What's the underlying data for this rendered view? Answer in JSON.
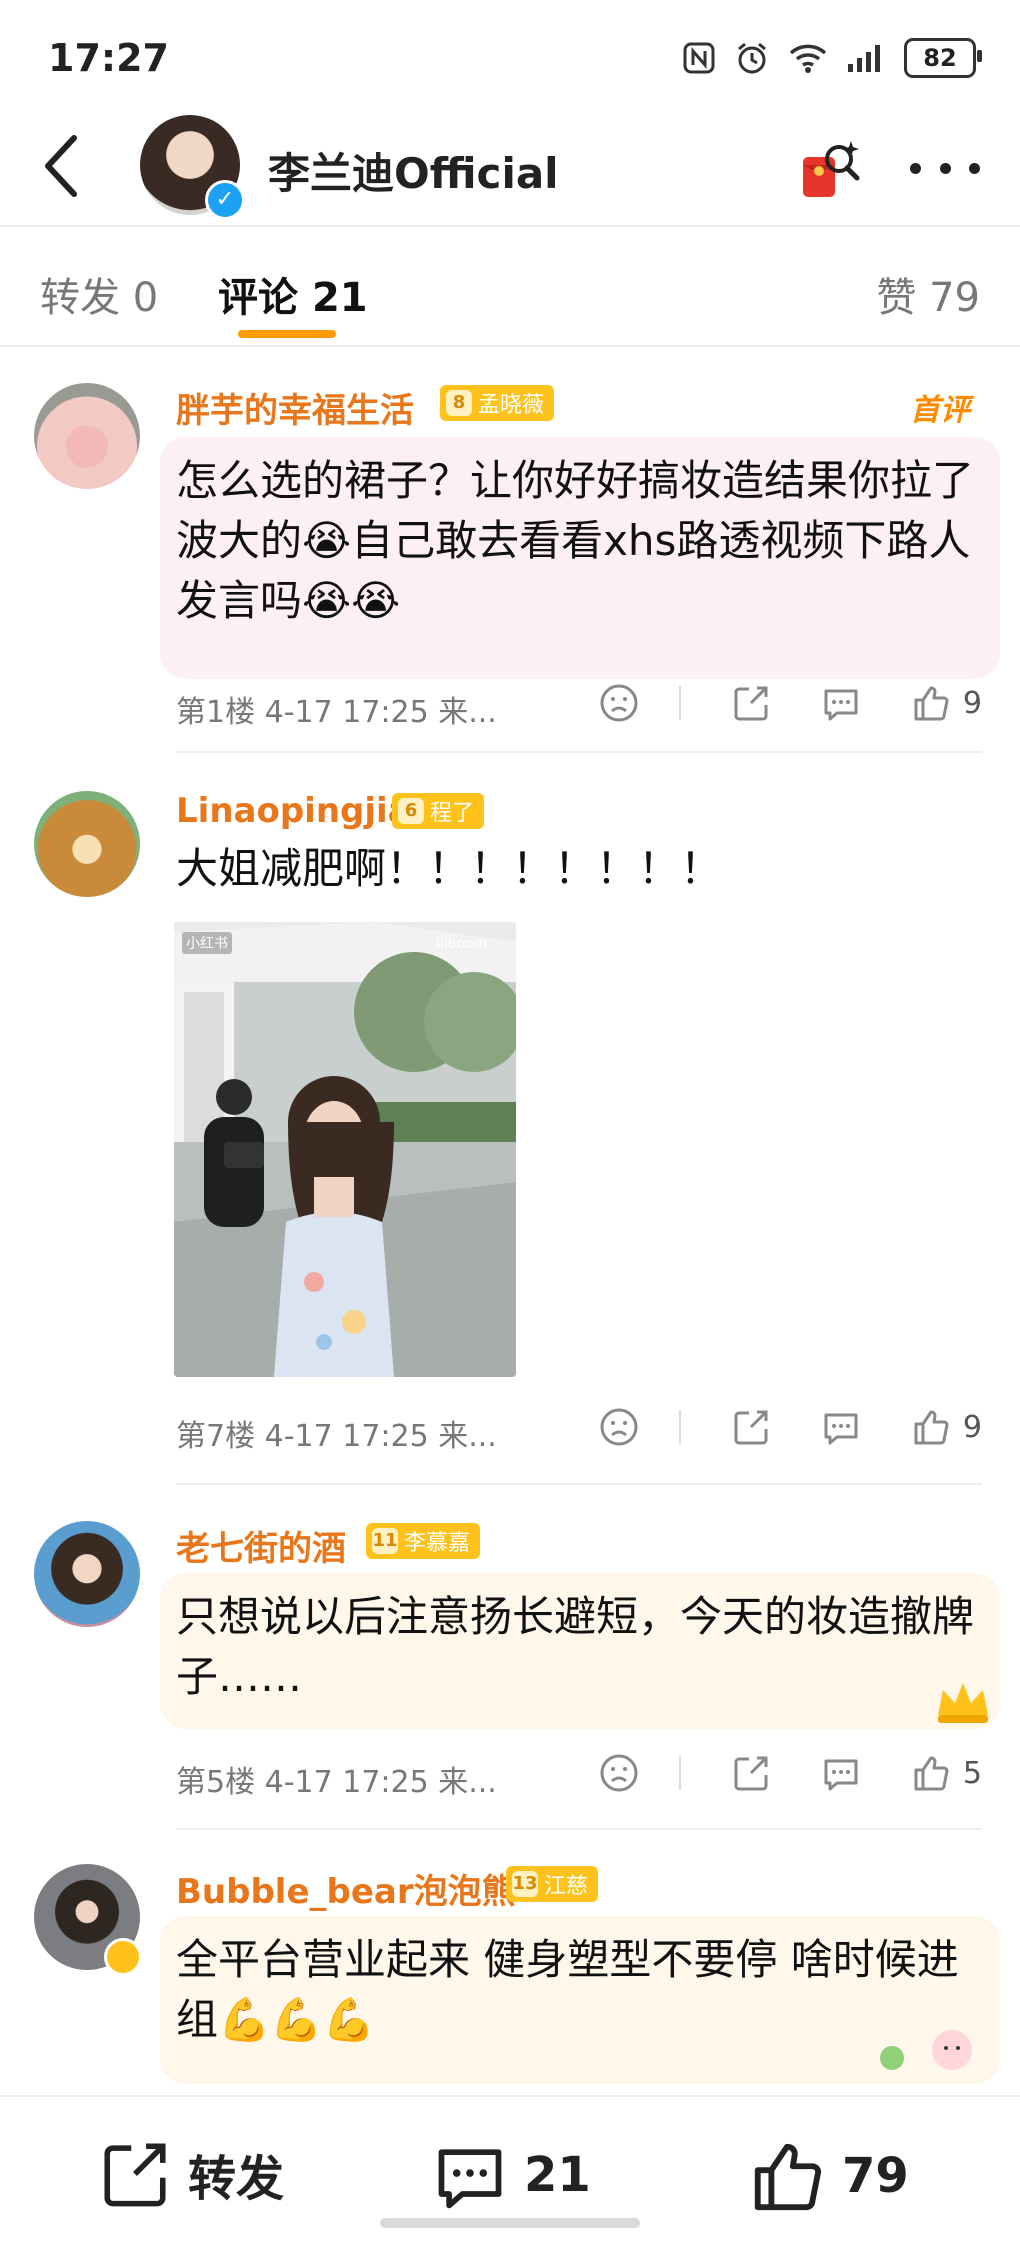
{
  "status_bar": {
    "time": "17:27",
    "battery": "82"
  },
  "header": {
    "title": "李兰迪Official"
  },
  "tabs": {
    "forward": {
      "label": "转发",
      "count": "0"
    },
    "comments": {
      "label": "评论",
      "count": "21"
    },
    "likes": {
      "label": "赞",
      "count": "79"
    }
  },
  "comments": [
    {
      "username": "胖芋的幸福生活",
      "badge_level": "8",
      "badge_name": "孟晓薇",
      "tag": "首评",
      "text": "怎么选的裙子？让你好好搞妆造结果你拉了波大的😭自己敢去看看xhs路透视频下路人发言吗😭😭",
      "meta": "第1楼 4-17 17:25 来...",
      "likes": "9"
    },
    {
      "username": "Linaopingjia",
      "badge_level": "6",
      "badge_name": "程了",
      "text": "大姐减肥啊！！！！！！！！",
      "image_watermark": "小红书",
      "image_watermark2": "iliboom",
      "meta": "第7楼 4-17 17:25 来...",
      "likes": "9"
    },
    {
      "username": "老七街的酒",
      "badge_level": "11",
      "badge_name": "李慕嘉",
      "text": "只想说以后注意扬长避短，今天的妆造撤牌子……",
      "meta": "第5楼 4-17 17:25 来...",
      "likes": "5"
    },
    {
      "username": "Bubble_bear泡泡熊",
      "badge_level": "13",
      "badge_name": "江慈",
      "text": "全平台营业起来 健身塑型不要停 啥时候进组💪💪💪"
    }
  ],
  "bottom_bar": {
    "forward_label": "转发",
    "comment_count": "21",
    "like_count": "79"
  },
  "colors": {
    "accent": "#ff9a00",
    "username": "#e8761a",
    "badge": "#ffc21a",
    "verified": "#1da1f2"
  },
  "icons": [
    "back-icon",
    "verified-icon",
    "red-packet-icon",
    "more-icon",
    "sad-face-icon",
    "share-icon",
    "comment-icon",
    "like-icon"
  ]
}
